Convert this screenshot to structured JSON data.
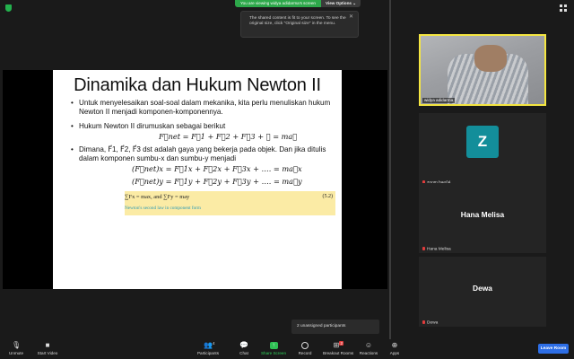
{
  "banner": {
    "viewing": "You are viewing widya adidarma's screen",
    "view_options": "View Options ⌄"
  },
  "tooltip": {
    "text": "The shared content is fit to your screen. To see the original size, click \"Original size\" in the menu."
  },
  "slide": {
    "title": "Dinamika dan Hukum Newton II",
    "bullet1": "Untuk menyelesaikan soal-soal dalam mekanika, kita perlu menuliskan hukum Newton II menjadi komponen-komponennya.",
    "bullet2": "Hukum Newton II dirumuskan sebagai berikut",
    "eq1": "F⃗net = F⃗1 + F⃗2 + F⃗3 + ⋯ = ma⃗",
    "bullet3": "Dimana, F⃗1, F⃗2, F⃗3 dst adalah gaya yang bekerja pada objek. Dan jika ditulis dalam komponen sumbu-x dan sumbu-y menjadi",
    "eq2": "(F⃗net)x = F⃗1x + F⃗2x + F⃗3x + …. = ma⃗x",
    "eq3": "(F⃗net)y = F⃗1y + F⃗2y + F⃗3y + …. = ma⃗y",
    "box_eq": "∑Fx = max,       and       ∑Fy = may",
    "box_num": "(5.2)",
    "box_caption": "Newton's second law in component form"
  },
  "participants": {
    "video_name": "widya adidarma",
    "zoom_initial": "Z",
    "zoom_name": "zoom bae04",
    "hana_name": "Hana Melisa",
    "hana_label": "Hana Melisa",
    "dewa_name": "Dewa",
    "dewa_label": "Dewa"
  },
  "breakout": {
    "unassigned": "2 unassigned participants"
  },
  "toolbar": {
    "unmute": "Unmute",
    "start_video": "Start Video",
    "participants": "Participants",
    "participants_count": "4",
    "chat": "Chat",
    "share_screen": "Share Screen",
    "record": "Record",
    "breakout_rooms": "Breakout Rooms",
    "breakout_badge": "2",
    "reactions": "Reactions",
    "apps": "Apps",
    "leave": "Leave Room"
  },
  "colors": {
    "accent_green": "#2da84a",
    "speaker_border": "#f5e641",
    "leave_blue": "#2d6ee6",
    "avatar_teal": "#138e9a",
    "muted_red": "#e03c3c"
  }
}
